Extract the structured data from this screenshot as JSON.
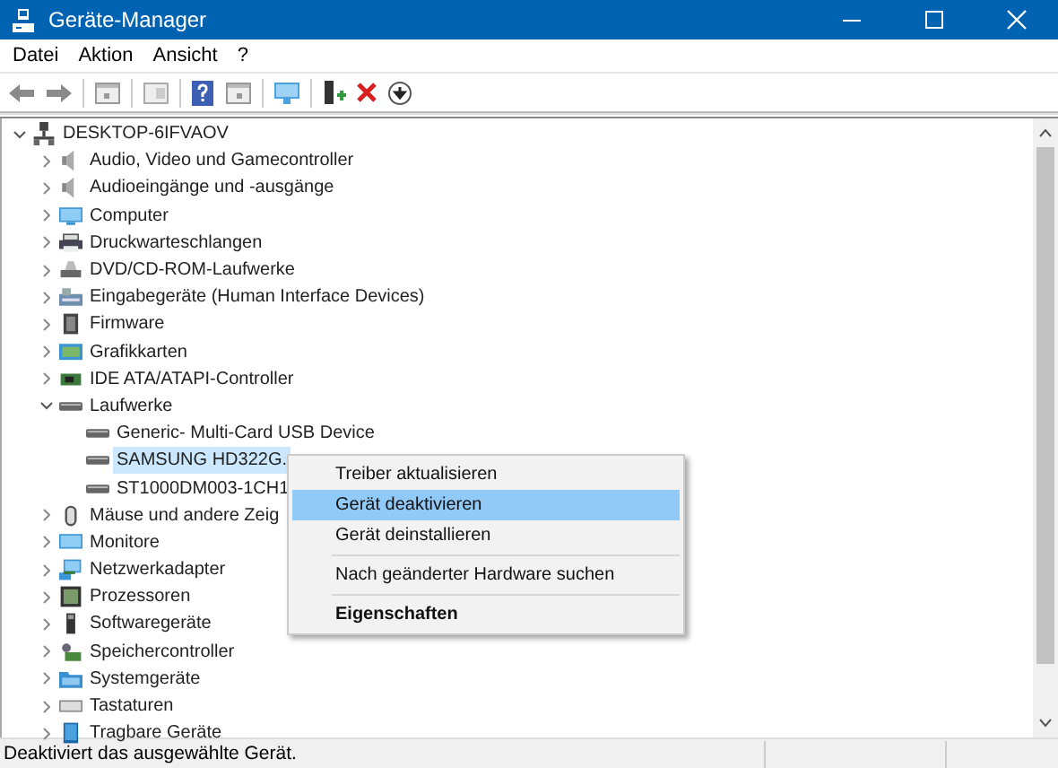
{
  "window": {
    "title": "Geräte-Manager"
  },
  "menu_bar": [
    "Datei",
    "Aktion",
    "Ansicht",
    "?"
  ],
  "tree": {
    "label": "DESKTOP-6IFVAOV",
    "expanded": true,
    "selected": false,
    "children": [
      {
        "label": "Audio, Video und Gamecontroller",
        "expanded": false,
        "selected": false
      },
      {
        "label": "Audioeingänge und -ausgänge",
        "expanded": false,
        "selected": false
      },
      {
        "label": "Computer",
        "expanded": false,
        "selected": false
      },
      {
        "label": "Druckwarteschlangen",
        "expanded": false,
        "selected": false
      },
      {
        "label": "DVD/CD-ROM-Laufwerke",
        "expanded": false,
        "selected": false
      },
      {
        "label": "Eingabegeräte (Human Interface Devices)",
        "expanded": false,
        "selected": false
      },
      {
        "label": "Firmware",
        "expanded": false,
        "selected": false
      },
      {
        "label": "Grafikkarten",
        "expanded": false,
        "selected": false
      },
      {
        "label": "IDE ATA/ATAPI-Controller",
        "expanded": false,
        "selected": false
      },
      {
        "label": "Laufwerke",
        "expanded": true,
        "selected": false,
        "children": [
          {
            "label": "Generic- Multi-Card USB Device",
            "selected": false
          },
          {
            "label": "SAMSUNG HD322G.",
            "selected": true
          },
          {
            "label": "ST1000DM003-1CH1",
            "selected": false
          }
        ]
      },
      {
        "label": "Mäuse und andere Zeig",
        "expanded": false,
        "selected": false
      },
      {
        "label": "Monitore",
        "expanded": false,
        "selected": false
      },
      {
        "label": "Netzwerkadapter",
        "expanded": false,
        "selected": false
      },
      {
        "label": "Prozessoren",
        "expanded": false,
        "selected": false
      },
      {
        "label": "Softwaregeräte",
        "expanded": false,
        "selected": false
      },
      {
        "label": "Speichercontroller",
        "expanded": false,
        "selected": false
      },
      {
        "label": "Systemgeräte",
        "expanded": false,
        "selected": false
      },
      {
        "label": "Tastaturen",
        "expanded": false,
        "selected": false
      },
      {
        "label": "Tragbare Geräte",
        "expanded": false,
        "selected": false
      }
    ]
  },
  "context_menu": [
    {
      "label": "Treiber aktualisieren",
      "selected": false,
      "default": false,
      "separator_before": false
    },
    {
      "label": "Gerät deaktivieren",
      "selected": true,
      "default": false,
      "separator_before": false
    },
    {
      "label": "Gerät deinstallieren",
      "selected": false,
      "default": false,
      "separator_before": false
    },
    {
      "label": "Nach geänderter Hardware suchen",
      "selected": false,
      "default": false,
      "separator_before": true
    },
    {
      "label": "Eigenschaften",
      "selected": false,
      "default": true,
      "separator_before": true
    }
  ],
  "status_bar": "Deaktiviert das ausgewählte Gerät."
}
